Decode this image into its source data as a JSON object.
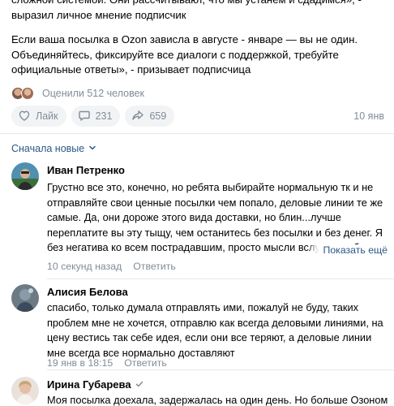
{
  "post": {
    "paragraph1": "сложной системой. Они рассчитывают, что мы устанем и сдадимся», - выразил личное мнение подписчик",
    "paragraph2": "Если ваша посылка в Ozon зависла в августе - январе — вы не один. Объединяйтесь, фиксируйте все диалоги с поддержкой, требуйте официальные ответы», - призывает подписчица",
    "rated_label": "Оценили 512 человек",
    "like_label": "Лайк",
    "comments_count": "231",
    "shares_count": "659",
    "time": "10 янв"
  },
  "sort": {
    "label": "Сначала новые",
    "icon": "chevron-down-icon"
  },
  "comments": [
    {
      "author": "Иван Петренко",
      "text": "Грустно все это, конечно, но ребята выбирайте нормальную тк и не отправляйте свои ценные посылки чем попало, деловые линии те же самые. Да, они дороже этого вида доставки, но блин...лучше переплатите вы эту тыщу, чем останитесь без посылки и без денег. Я без негатива ко всем пострадавшим, просто мысли вслух, в любом случае на ошибках учатся, надеюсь, что этот кошмар ре",
      "time": "10 секунд назад",
      "reply": "Ответить",
      "show_all": "Показать ещё"
    },
    {
      "author": "Алисия Белова",
      "text": "спасибо, только думала отправлять ими, пожалуй не буду, таких проблем мне не хочется, отправлю как всегда деловыми линиями, на цену вестись так себе идея, если они все теряют, а деловые линии мне всегда все нормально доставляют",
      "time": "19 янв в 18:15",
      "reply": "Ответить"
    },
    {
      "author": "Ирина Губарева",
      "text": "Моя посылка доехала, задержалась на один день. Но больше Озоном",
      "verified": true
    }
  ],
  "colors": {
    "accent": "#2a5885",
    "muted": "#818c99",
    "pill": "#f2f3f5"
  }
}
